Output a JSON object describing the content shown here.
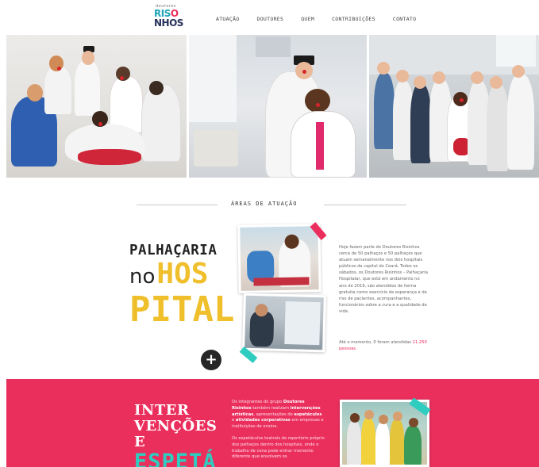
{
  "header": {
    "logo": {
      "tagline": "doutores",
      "line1_a": "RIS",
      "line1_dot": "O",
      "line2": "NHOS"
    },
    "nav": [
      {
        "label": "Atuação"
      },
      {
        "label": "Doutores"
      },
      {
        "label": "Quem"
      },
      {
        "label": "Contribuições"
      },
      {
        "label": "Contato"
      }
    ]
  },
  "areas": {
    "section_title": "Áreas de atuação",
    "hospital": {
      "title_line1": "PALHAÇARIA",
      "title_no": "no",
      "title_hos": "HOS",
      "title_pital": "PITAL",
      "plus_label": "+",
      "body": "Hoje fazem parte do Doutores Risinhos cerca de 50 palhaços e 50 palhaços que atuam semanalmente nos dois hospitais públicos da capital do Ceará. Todos os sábados, os Doutores Risinhos – Palhaçaria Hospitalar, que está em andamento no ano de 2016, são atendidos de forma gratuita como exercício da esperança e do riso de pacientes, acompanhantes, funcionários sobre a cura e a qualidade de vida.",
      "link_prefix": "Até o momento, 0 foram atendidas",
      "link_text": "11.250 pessoas."
    }
  },
  "intervencoes": {
    "title_line1": "INTER",
    "title_line2": "VENÇÕES E",
    "title_line3": "ESPETÁ",
    "body1_prefix": "Os integrantes do grupo",
    "body1_bold1": "Doutores Risinhos",
    "body1_mid": "também realizam",
    "body1_bold2": "intervenções artísticas",
    "body1_mid2": ", apresentações de",
    "body1_bold3": "espetáculos",
    "body1_mid3": "e",
    "body1_bold4": "atividades corporativas",
    "body1_suffix": "em empresas e instituições de ensino.",
    "body2": "Os espetáculos teatrais de repertório próprio dos palhaços dentro dos hospitais, onde o trabalho de cena pode entrar momento diferente que envolvem os"
  },
  "colors": {
    "accent_pink": "#ea2f5d",
    "accent_yellow": "#f0bf2c",
    "accent_teal": "#2ecdc0",
    "logo_navy": "#27305c"
  }
}
